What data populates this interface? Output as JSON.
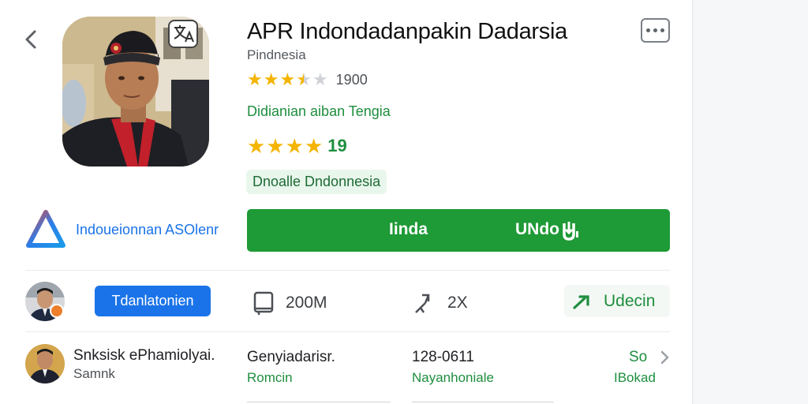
{
  "app": {
    "title": "APR Indondadanpakin Dadarsia",
    "developer": "Pindnesia",
    "rating_count": "1900",
    "category": "Didianian aiban Tengia",
    "score": "19",
    "tag_chip": "Dnoalle Dndonnesia",
    "rating_stars": 3.5,
    "score_stars": 4
  },
  "brand": {
    "label": "Indoueionnan ASOlenr"
  },
  "install_button": {
    "left_label": "Iinda",
    "right_label": "UNdo"
  },
  "info_row": {
    "follow_button": "Tdanlatonien",
    "downloads": "200M",
    "shares": "2X",
    "update_label": "Udecin"
  },
  "details_row": {
    "col1_title": "Snksisk ePhamiolyai.",
    "col1_sub": "Samnk",
    "col2_title": "Genyiadarisr.",
    "col2_sub": "Romcin",
    "col3_title": "128-0611",
    "col3_sub": "Nayanhoniale",
    "col4_title": "So",
    "col4_sub": "IBokad"
  },
  "colors": {
    "install_green": "#1e9a36",
    "link_blue": "#1a73e8",
    "accent_green": "#1e8e3e",
    "star_gold": "#f4b400"
  },
  "icons": [
    "back-arrow-icon",
    "more-menu-icon",
    "translate-badge-icon",
    "brand-triangle-logo",
    "book-icon",
    "share-icon",
    "update-arrow-icon",
    "chevron-right-icon"
  ]
}
